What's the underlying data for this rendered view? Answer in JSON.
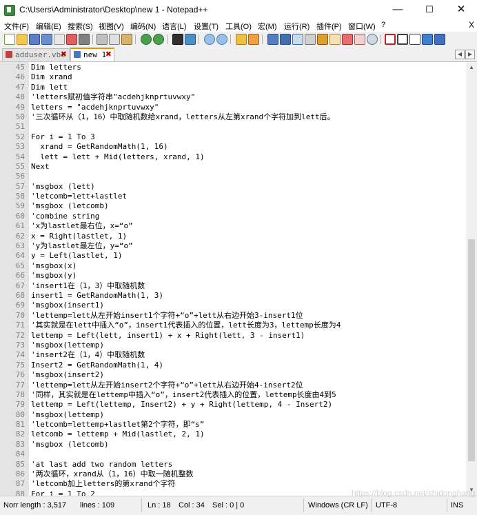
{
  "window": {
    "title": "C:\\Users\\Administrator\\Desktop\\new 1 - Notepad++",
    "controls": {
      "minimize": "—",
      "maximize": "☐",
      "close": "✕"
    }
  },
  "menu": {
    "items": [
      "文件(F)",
      "编辑(E)",
      "搜索(S)",
      "视图(V)",
      "编码(N)",
      "语言(L)",
      "设置(T)",
      "工具(O)",
      "宏(M)",
      "运行(R)",
      "插件(P)",
      "窗口(W)",
      "?"
    ],
    "close": "X"
  },
  "tabs": [
    {
      "label": "adduser.vbe",
      "active": false
    },
    {
      "label": "new 1",
      "active": true
    }
  ],
  "editor": {
    "lines": [
      {
        "n": "45",
        "t": "Dim letters"
      },
      {
        "n": "46",
        "t": "Dim xrand"
      },
      {
        "n": "47",
        "t": "Dim lett"
      },
      {
        "n": "48",
        "t": "'letters赋初值字符串\"acdehjknprtuvwxy\""
      },
      {
        "n": "49",
        "t": "letters = \"acdehjknprtuvwxy\""
      },
      {
        "n": "50",
        "t": "'三次循环从（1，16）中取随机数给xrand，letters从左第xrand个字符加到lett后。"
      },
      {
        "n": "51",
        "t": ""
      },
      {
        "n": "52",
        "t": "For i = 1 To 3"
      },
      {
        "n": "53",
        "t": "  xrand = GetRandomMath(1, 16)"
      },
      {
        "n": "54",
        "t": "  lett = lett + Mid(letters, xrand, 1)"
      },
      {
        "n": "55",
        "t": "Next"
      },
      {
        "n": "56",
        "t": ""
      },
      {
        "n": "57",
        "t": "'msgbox (lett)"
      },
      {
        "n": "58",
        "t": "'letcomb=lett+lastlet"
      },
      {
        "n": "59",
        "t": "'msgbox (letcomb)"
      },
      {
        "n": "60",
        "t": "'combine string"
      },
      {
        "n": "61",
        "t": "'x为lastlet最右位，x=“o”"
      },
      {
        "n": "62",
        "t": "x = Right(lastlet, 1)"
      },
      {
        "n": "63",
        "t": "'y为lastlet最左位，y=“o”"
      },
      {
        "n": "64",
        "t": "y = Left(lastlet, 1)"
      },
      {
        "n": "65",
        "t": "'msgbox(x)"
      },
      {
        "n": "66",
        "t": "'msgbox(y)"
      },
      {
        "n": "67",
        "t": "'insert1在（1，3）中取随机数"
      },
      {
        "n": "68",
        "t": "insert1 = GetRandomMath(1, 3)"
      },
      {
        "n": "69",
        "t": "'msgbox(insert1)"
      },
      {
        "n": "70",
        "t": "'lettemp=lett从左开始insert1个字符+“o”+lett从右边开始3-insert1位"
      },
      {
        "n": "71",
        "t": "'其实就是在lett中插入“o”，insert1代表插入的位置，lett长度为3，lettemp长度为4"
      },
      {
        "n": "72",
        "t": "lettemp = Left(lett, insert1) + x + Right(lett, 3 - insert1)"
      },
      {
        "n": "73",
        "t": "'msgbox(lettemp)"
      },
      {
        "n": "74",
        "t": "'insert2在（1，4）中取随机数"
      },
      {
        "n": "75",
        "t": "Insert2 = GetRandomMath(1, 4)"
      },
      {
        "n": "76",
        "t": "'msgbox(insert2)"
      },
      {
        "n": "77",
        "t": "'lettemp=lett从左开始insert2个字符+“o”+lett从右边开始4-insert2位"
      },
      {
        "n": "78",
        "t": "'同样，其实就是在lettemp中插入“o”，insert2代表插入的位置，lettemp长度由4到5"
      },
      {
        "n": "79",
        "t": "lettemp = Left(lettemp, Insert2) + y + Right(lettemp, 4 - Insert2)"
      },
      {
        "n": "80",
        "t": "'msgbox(lettemp)"
      },
      {
        "n": "81",
        "t": "'letcomb=lettemp+lastlet第2个字符，即“s”"
      },
      {
        "n": "82",
        "t": "letcomb = lettemp + Mid(lastlet, 2, 1)"
      },
      {
        "n": "83",
        "t": "'msgbox (letcomb)"
      },
      {
        "n": "84",
        "t": ""
      },
      {
        "n": "85",
        "t": "'at last add two random letters"
      },
      {
        "n": "86",
        "t": "'两次循环，xrand从（1，16）中取一随机整数"
      },
      {
        "n": "87",
        "t": "'letcomb加上letters的第xrand个字符"
      },
      {
        "n": "88",
        "t": "For i = 1 To 2"
      }
    ]
  },
  "status": {
    "length": "Norr length : 3,517",
    "lines": "lines : 109",
    "ln": "Ln : 18",
    "col": "Col : 34",
    "sel": "Sel : 0 | 0",
    "eol": "Windows (CR LF)",
    "encoding": "UTF-8",
    "mode": "INS"
  },
  "watermark": "https://blog.csdn.net/shidonghang",
  "colors": {
    "tab_accent": "#f08c00",
    "gutter_bg": "#e4e4e4",
    "line_number": "#808080"
  }
}
